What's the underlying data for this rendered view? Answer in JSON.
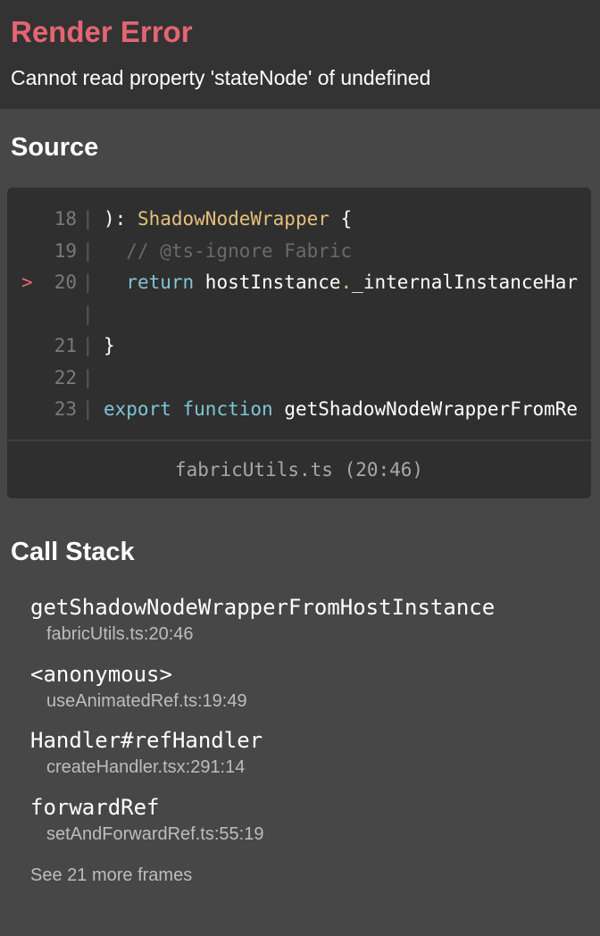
{
  "header": {
    "title": "Render Error",
    "message": "Cannot read property 'stateNode' of undefined"
  },
  "source": {
    "heading": "Source",
    "lines": [
      {
        "number": "18",
        "marker": "",
        "tokens": [
          {
            "text": "): ",
            "cls": ""
          },
          {
            "text": "ShadowNodeWrapper",
            "cls": "tok-type"
          },
          {
            "text": " {",
            "cls": ""
          }
        ]
      },
      {
        "number": "19",
        "marker": "",
        "tokens": [
          {
            "text": "  // @ts-ignore Fabric",
            "cls": "tok-comment"
          }
        ]
      },
      {
        "number": "20",
        "marker": ">",
        "tokens": [
          {
            "text": "  ",
            "cls": ""
          },
          {
            "text": "return",
            "cls": "tok-kw"
          },
          {
            "text": " hostInstance",
            "cls": ""
          },
          {
            "text": ".",
            "cls": "tok-dot"
          },
          {
            "text": "_internalInstanceHar",
            "cls": ""
          }
        ]
      },
      {
        "number": "",
        "marker": "",
        "tokens": []
      },
      {
        "number": "21",
        "marker": "",
        "tokens": [
          {
            "text": "}",
            "cls": ""
          }
        ]
      },
      {
        "number": "22",
        "marker": "",
        "tokens": []
      },
      {
        "number": "23",
        "marker": "",
        "tokens": [
          {
            "text": "export",
            "cls": "tok-kw"
          },
          {
            "text": " ",
            "cls": ""
          },
          {
            "text": "function",
            "cls": "tok-kw"
          },
          {
            "text": " getShadowNodeWrapperFromRe",
            "cls": ""
          }
        ]
      }
    ],
    "file_location": "fabricUtils.ts (20:46)"
  },
  "call_stack": {
    "heading": "Call Stack",
    "frames": [
      {
        "name": "getShadowNodeWrapperFromHostInstance",
        "location": "fabricUtils.ts:20:46"
      },
      {
        "name": "<anonymous>",
        "location": "useAnimatedRef.ts:19:49"
      },
      {
        "name": "Handler#refHandler",
        "location": "createHandler.tsx:291:14"
      },
      {
        "name": "forwardRef",
        "location": "setAndForwardRef.ts:55:19"
      }
    ],
    "more_frames_label": "See 21 more frames"
  },
  "colors": {
    "error_title": "#e56572",
    "background": "#474747",
    "header_background": "#333333",
    "code_background": "#2f2f2f"
  }
}
